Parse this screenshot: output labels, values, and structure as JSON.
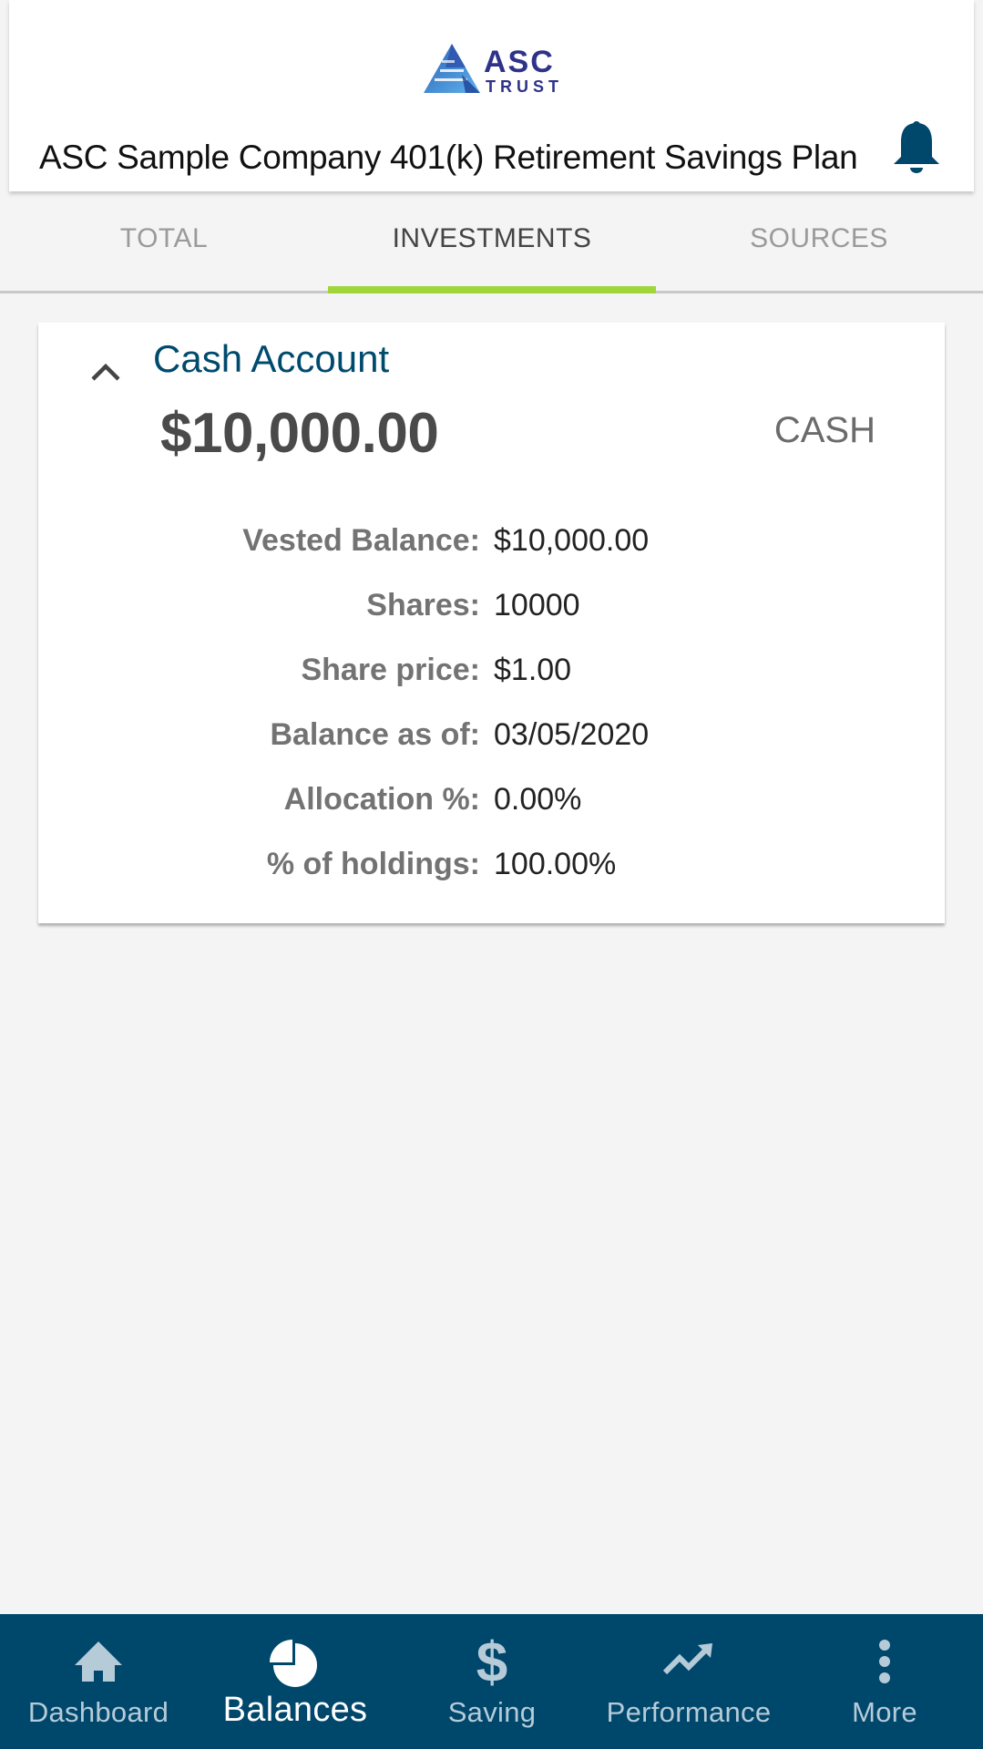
{
  "header": {
    "logo": {
      "line1": "ASC",
      "line2": "TRUST",
      "colors": {
        "text": "#2e3388",
        "triangle": "#3a78c8"
      }
    },
    "plan_title": "ASC Sample Company 401(k) Retirement Savings Plan",
    "notification_icon": "bell-icon"
  },
  "tabs": [
    {
      "label": "TOTAL",
      "active": false
    },
    {
      "label": "INVESTMENTS",
      "active": true
    },
    {
      "label": "SOURCES",
      "active": false
    }
  ],
  "investment_card": {
    "expanded": true,
    "toggle_icon": "chevron-up-icon",
    "name": "Cash Account",
    "balance": "$10,000.00",
    "type": "CASH",
    "details": [
      {
        "label": "Vested Balance:",
        "value": "$10,000.00"
      },
      {
        "label": "Shares:",
        "value": "10000"
      },
      {
        "label": "Share price:",
        "value": "$1.00"
      },
      {
        "label": "Balance as of:",
        "value": "03/05/2020"
      },
      {
        "label": "Allocation %:",
        "value": "0.00%"
      },
      {
        "label": "% of holdings:",
        "value": "100.00%"
      }
    ]
  },
  "bottom_nav": [
    {
      "label": "Dashboard",
      "icon": "home-icon",
      "active": false
    },
    {
      "label": "Balances",
      "icon": "pie-chart-icon",
      "active": true
    },
    {
      "label": "Saving",
      "icon": "dollar-icon",
      "active": false
    },
    {
      "label": "Performance",
      "icon": "trending-up-icon",
      "active": false
    },
    {
      "label": "More",
      "icon": "more-vertical-icon",
      "active": false
    }
  ],
  "colors": {
    "primary": "#00476c",
    "accent": "#9fd63a",
    "account_name": "#004a6e",
    "background": "#f4f4f4"
  }
}
